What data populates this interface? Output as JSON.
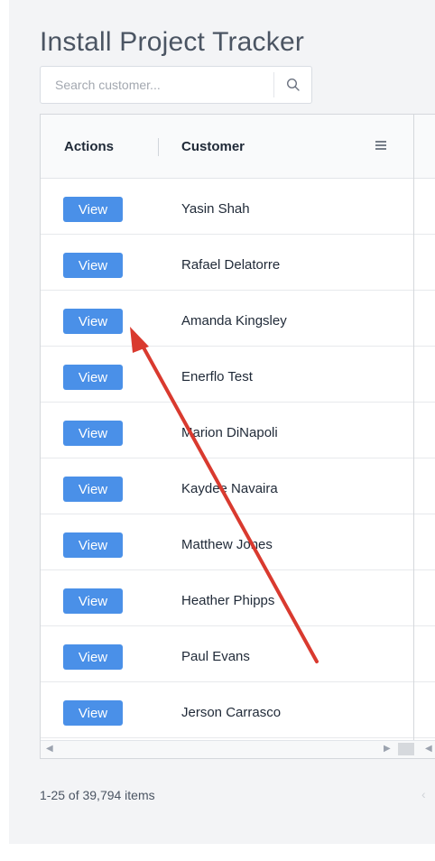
{
  "page": {
    "title": "Install Project Tracker"
  },
  "search": {
    "placeholder": "Search customer...",
    "value": "",
    "button_icon": "search-icon"
  },
  "grid": {
    "columns": [
      "Actions",
      "Customer"
    ],
    "header_menu_icon": "menu-icon",
    "rows": [
      {
        "action": "View",
        "customer": "Yasin Shah"
      },
      {
        "action": "View",
        "customer": "Rafael Delatorre"
      },
      {
        "action": "View",
        "customer": "Amanda Kingsley"
      },
      {
        "action": "View",
        "customer": "Enerflo Test"
      },
      {
        "action": "View",
        "customer": "Marion DiNapoli"
      },
      {
        "action": "View",
        "customer": "Kaydee Navaira"
      },
      {
        "action": "View",
        "customer": "Matthew Jones"
      },
      {
        "action": "View",
        "customer": "Heather Phipps"
      },
      {
        "action": "View",
        "customer": "Paul Evans"
      },
      {
        "action": "View",
        "customer": "Jerson Carrasco"
      }
    ]
  },
  "pager": {
    "summary": "1-25 of 39,794 items",
    "prev_icon": "chevron-left-icon"
  },
  "annotation": {
    "type": "arrow",
    "color": "#d93a2f"
  },
  "colors": {
    "button_bg": "#4a90e8",
    "panel_bg": "#f3f4f6"
  }
}
